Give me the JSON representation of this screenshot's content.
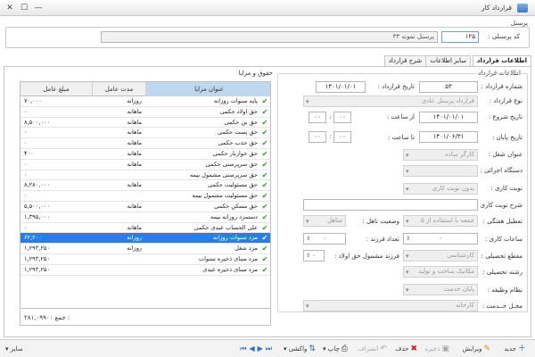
{
  "window": {
    "title": "قرارداد کار",
    "minimize": "—",
    "maximize": "☐",
    "close": "✕"
  },
  "personnel": {
    "group_label": "پرسنل",
    "code_label": "کد پرسنلی :",
    "code_value": "۱۲۵",
    "name_value": "پرسنل نمونه ۳۳"
  },
  "tabs": [
    {
      "label": "اطلاعات قرارداد",
      "active": true
    },
    {
      "label": "سایر اطلاعات",
      "active": false
    },
    {
      "label": "شرح قرارداد",
      "active": false
    }
  ],
  "contract": {
    "group_label": "اطلاعات قرارداد",
    "number_label": "شماره قرارداد :",
    "number_value": "۵۳",
    "date_label": "تاریخ قرارداد :",
    "date_value": "۱۴۰۱/۰۱/۰۱",
    "type_label": "نوع قرارداد :",
    "type_value": "قرارداد پرسنل عادی",
    "start_label": "تاریخ شروع :",
    "start_value": "۱۴۰۱/۰۱/۰۱",
    "from_hour_label": "از ساعت :",
    "hour_h": "۰۰",
    "hour_m": "۰۰",
    "end_label": "تاریخ پایان :",
    "end_value": "۱۴۰۱/۰۶/۳۱",
    "to_hour_label": "تا ساعت :",
    "to_h": "۰۰",
    "to_m": "۰۰",
    "job_title_label": "عنوان شغل :",
    "job_title_value": "کارگر ساده",
    "exec_unit_label": "دستگاه اجرائی :",
    "exec_unit_value": "",
    "shift_label": "نوبت کاری :",
    "shift_value": "بدون نوبت کاری",
    "shift_desc_label": "شرح نوبت کاری :",
    "shift_desc_value": "",
    "holiday_label": "تعطیل هفتگی :",
    "holiday_value": "جمعه با استفاده از ۵",
    "marital_label": "وضعیت تاهل :",
    "marital_value": "متاهل",
    "work_hours_label": "ساعات کاری :",
    "work_hours_value": "۰",
    "children_label": "تعداد فرزند :",
    "children_value": "۰",
    "education_label": "مقطع تحصیلی :",
    "education_value": "کارشناسی",
    "child_allow_label": "فرزند مشمول حق اولاد :",
    "child_allow_value": "۰",
    "field_label": "رشته تحصیلی :",
    "field_value": "مکانیک ساخت و تولید",
    "position_label": "نظام وظیفه :",
    "position_value": "پایان خدمت",
    "service_place_label": "محـل خــدمت :",
    "service_place_value": "کارخانه"
  },
  "benefits": {
    "group_label": "حقوق و مزایا",
    "headers": {
      "title": "عنوان مزایا",
      "period": "مدت عامل",
      "amount": "مبلغ عامل"
    },
    "rows": [
      {
        "title": "پایه سنوات روزانه",
        "period": "روزانه",
        "amount": "۷۰,۰۰۰",
        "selected": false
      },
      {
        "title": "حق اولاد حکمی",
        "period": "ماهانه",
        "amount": "۰",
        "selected": false
      },
      {
        "title": "حق بن حکمی",
        "period": "ماهانه",
        "amount": "۸,۵۰۰,۰۰۰",
        "selected": false
      },
      {
        "title": "حق پست حکمی",
        "period": "ماهانه",
        "amount": "۰",
        "selected": false
      },
      {
        "title": "حق جذب حکمی",
        "period": "ماهانه",
        "amount": "۰",
        "selected": false
      },
      {
        "title": "حق خواربار حکمی",
        "period": "ماهانه",
        "amount": "۴۰۰",
        "selected": false
      },
      {
        "title": "حق سرپرستی حکمی",
        "period": "ماهانه",
        "amount": "۰",
        "selected": false
      },
      {
        "title": "حق سرپرستی مشمول بیمه",
        "period": "",
        "amount": "۰",
        "selected": false
      },
      {
        "title": "حق مسئولیت حکمی",
        "period": "ماهانه",
        "amount": "۸,۲۸۰,۰۰۰",
        "selected": false
      },
      {
        "title": "حق مسئولیت مشمول بیمه",
        "period": "",
        "amount": "۰",
        "selected": false
      },
      {
        "title": "حق مسکن حکمی",
        "period": "ماهانه",
        "amount": "۵,۵۰۰,۰۰۰",
        "selected": false
      },
      {
        "title": "دستمزد روزانه بیمه",
        "period": "",
        "amount": "۱,۳۹۵,۰۰۰",
        "selected": false
      },
      {
        "title": "علی الحساب عیدی حکمی",
        "period": "ماهانه",
        "amount": "۰",
        "selected": false
      },
      {
        "title": "مزد سنوات روزانه",
        "period": "روزانه",
        "amount": "۶۲,۲۰۰",
        "selected": true
      },
      {
        "title": "مزد شغل",
        "period": "روزانه",
        "amount": "۱,۲۹۳,۲۵۰",
        "selected": false
      },
      {
        "title": "مزد مبنای ذخیره سنوات",
        "period": "",
        "amount": "۱,۲۹۳,۲۵۰",
        "selected": false
      },
      {
        "title": "مزد مبنای ذخیره عیدی",
        "period": "",
        "amount": "۱,۲۹۳,۲۵۰",
        "selected": false
      }
    ],
    "total_label": "جمع :",
    "total_value": "۲۸۱,۰۹۹۰۰"
  },
  "toolbar": {
    "new": "جدید",
    "edit": "ویرایش",
    "save": "ذخیره",
    "delete": "حذف",
    "cancel": "انصراف",
    "print": "چاپ",
    "search": "واکشی",
    "other": "سایر"
  }
}
